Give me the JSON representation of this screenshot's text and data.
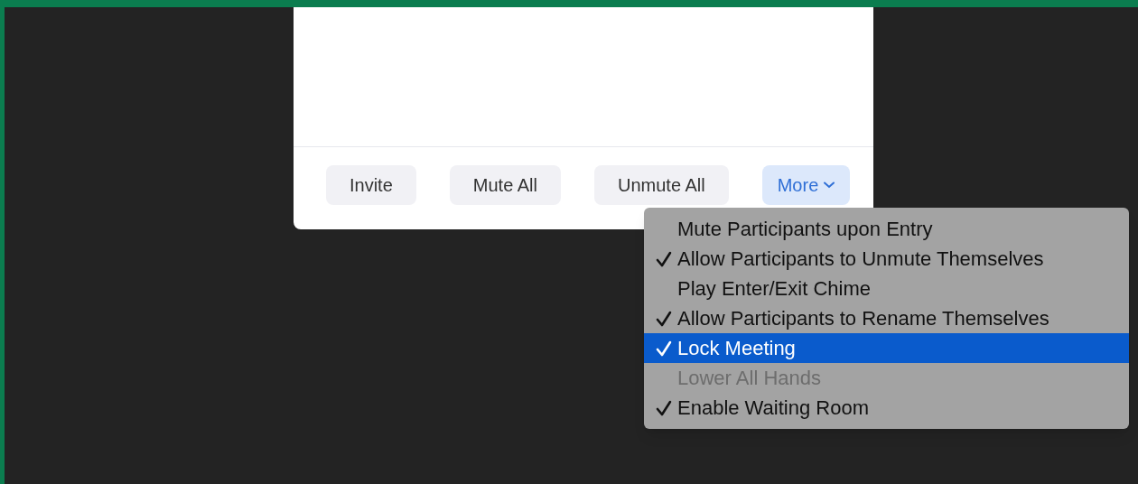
{
  "buttons": [
    {
      "label": "Invite",
      "kind": "plain"
    },
    {
      "label": "Mute All",
      "kind": "plain"
    },
    {
      "label": "Unmute All",
      "kind": "plain"
    },
    {
      "label": "More",
      "kind": "dropdown",
      "expanded": true
    }
  ],
  "menu": {
    "items": [
      {
        "label": "Mute Participants upon Entry",
        "checked": false,
        "selected": false,
        "disabled": false
      },
      {
        "label": "Allow Participants to Unmute Themselves",
        "checked": true,
        "selected": false,
        "disabled": false
      },
      {
        "label": "Play Enter/Exit Chime",
        "checked": false,
        "selected": false,
        "disabled": false
      },
      {
        "label": "Allow Participants to Rename Themselves",
        "checked": true,
        "selected": false,
        "disabled": false
      },
      {
        "label": "Lock Meeting",
        "checked": true,
        "selected": true,
        "disabled": false
      },
      {
        "label": "Lower All Hands",
        "checked": false,
        "selected": false,
        "disabled": true
      },
      {
        "label": "Enable Waiting Room",
        "checked": true,
        "selected": false,
        "disabled": false
      }
    ]
  }
}
